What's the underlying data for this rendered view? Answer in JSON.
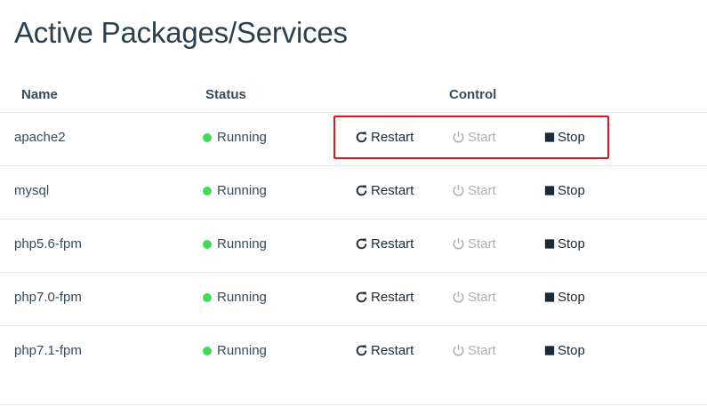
{
  "page": {
    "title": "Active Packages/Services"
  },
  "columns": {
    "name": "Name",
    "status": "Status",
    "control": "Control"
  },
  "controls": {
    "restart_label": "Restart",
    "start_label": "Start",
    "stop_label": "Stop",
    "restart_icon": "refresh-icon",
    "start_icon": "power-icon",
    "stop_icon": "stop-square-icon"
  },
  "colors": {
    "running": "#3ddc59",
    "highlight": "#e4141b",
    "disabled": "#a9b0b6"
  },
  "services": [
    {
      "name": "apache2",
      "status": "Running"
    },
    {
      "name": "mysql",
      "status": "Running"
    },
    {
      "name": "php5.6-fpm",
      "status": "Running"
    },
    {
      "name": "php7.0-fpm",
      "status": "Running"
    },
    {
      "name": "php7.1-fpm",
      "status": "Running"
    }
  ]
}
